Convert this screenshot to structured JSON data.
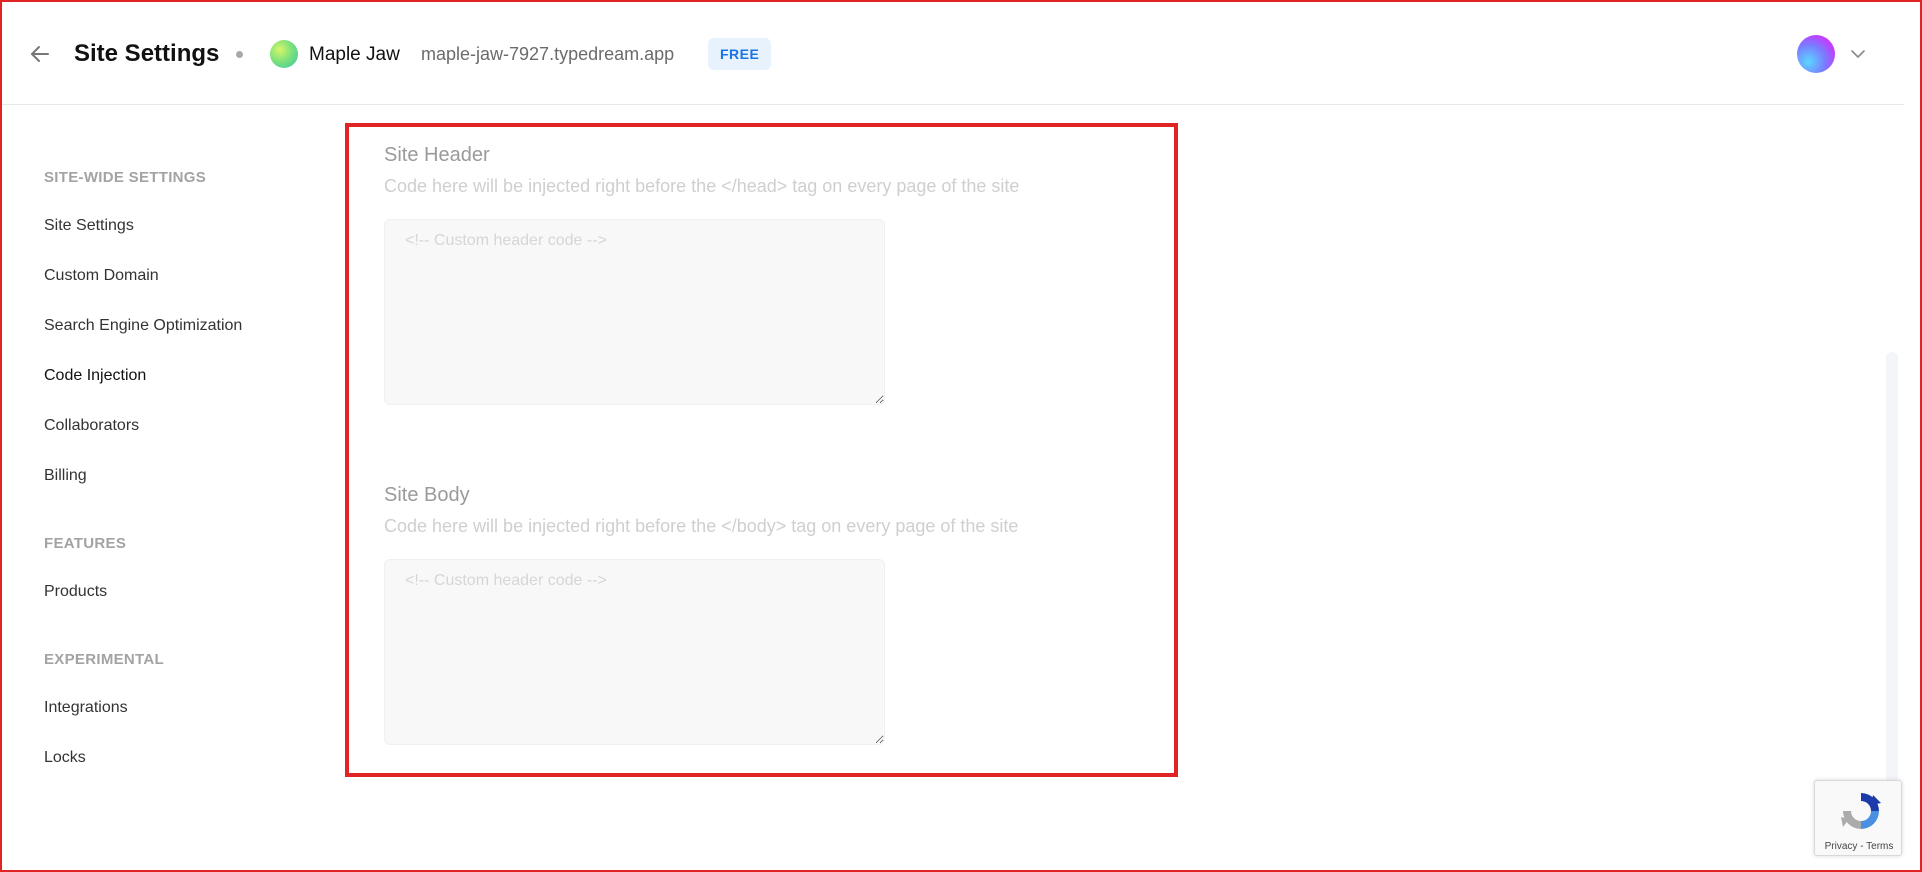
{
  "header": {
    "title": "Site Settings",
    "site_name": "Maple Jaw",
    "site_url": "maple-jaw-7927.typedream.app",
    "plan_badge": "FREE",
    "icons": {
      "back": "arrow-left-icon",
      "avatar": "avatar",
      "menu": "chevron-down-icon"
    }
  },
  "sidebar": {
    "sections": [
      {
        "heading": "SITE-WIDE SETTINGS",
        "items": [
          "Site Settings",
          "Custom Domain",
          "Search Engine Optimization",
          "Code Injection",
          "Collaborators",
          "Billing"
        ]
      },
      {
        "heading": "FEATURES",
        "items": [
          "Products"
        ]
      },
      {
        "heading": "EXPERIMENTAL",
        "items": [
          "Integrations",
          "Locks"
        ]
      }
    ],
    "active_item": "Code Injection"
  },
  "main": {
    "site_header": {
      "title": "Site Header",
      "description": "Code here will be injected right before the </head> tag on every page of the site",
      "value": "",
      "placeholder": "<!-- Custom header code -->"
    },
    "site_body": {
      "title": "Site Body",
      "description": "Code here will be injected right before the </body> tag on every page of the site",
      "value": "",
      "placeholder": "<!-- Custom header code -->"
    }
  },
  "recaptcha": {
    "links": "Privacy - Terms"
  },
  "colors": {
    "accent": "#1a73e8",
    "badge_bg": "#e7f2fd",
    "highlight": "#e02424"
  }
}
